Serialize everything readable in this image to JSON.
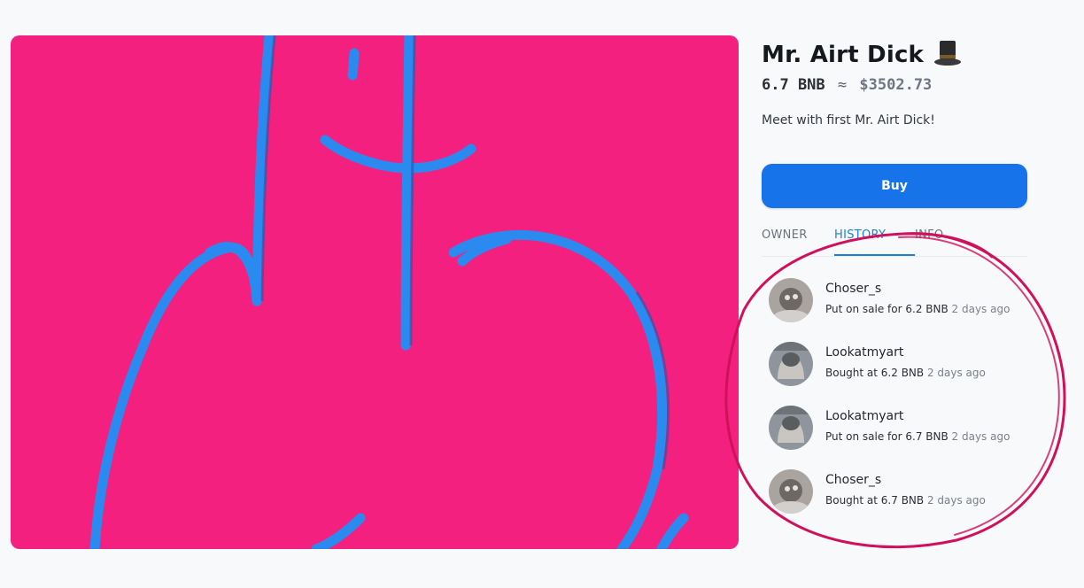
{
  "nft": {
    "title": "Mr. Airt Dick",
    "price_bnb": "6.7 BNB",
    "approx": "≈",
    "price_usd": "$3502.73",
    "description": "Meet with first Mr. Airt Dick!",
    "hat_icon": "top-hat-icon"
  },
  "buy_button": {
    "label": "Buy"
  },
  "tabs": [
    {
      "label": "OWNER",
      "active": false
    },
    {
      "label": "HISTORY",
      "active": true
    },
    {
      "label": "INFO",
      "active": false
    }
  ],
  "history": [
    {
      "user": "Choser_s",
      "action": "Put on sale for 6.2 BNB",
      "time": "2 days ago"
    },
    {
      "user": "Lookatmyart",
      "action": "Bought at 6.2 BNB",
      "time": "2 days ago"
    },
    {
      "user": "Lookatmyart",
      "action": "Put on sale for 6.7 BNB",
      "time": "2 days ago"
    },
    {
      "user": "Choser_s",
      "action": "Bought at 6.7 BNB",
      "time": "2 days ago"
    }
  ],
  "colors": {
    "artwork_bg": "#f4207f",
    "artwork_stroke": "#2a8af0",
    "accent": "#1673ea",
    "annotation_circle": "#d0105a"
  }
}
